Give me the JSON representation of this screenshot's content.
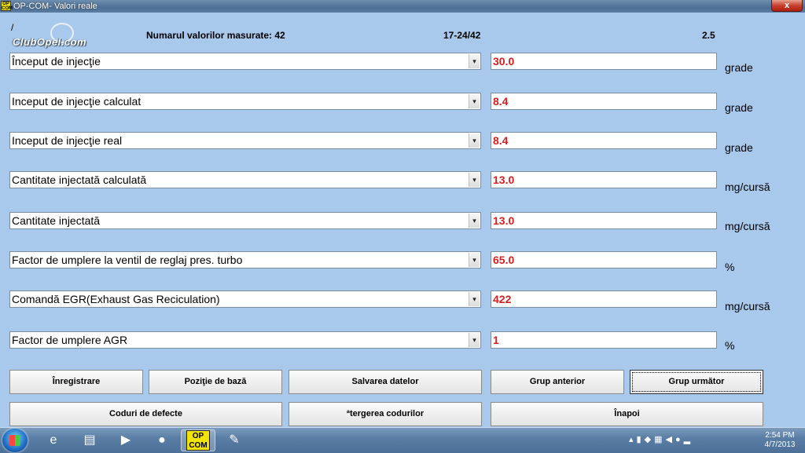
{
  "window": {
    "title": "OP-COM- Valori reale",
    "app_icon_line1": "OP",
    "app_icon_line2": "COM",
    "close_label": "x"
  },
  "header": {
    "slash": "/",
    "logo": "ClubOpel.com",
    "count_label": "Numarul valorilor masurate: 42",
    "range": "17-24/42",
    "version": "2.5"
  },
  "rows": [
    {
      "label": "Început de injecţie",
      "value": "30.0",
      "unit": "grade"
    },
    {
      "label": "Inceput de injecţie calculat",
      "value": "8.4",
      "unit": "grade"
    },
    {
      "label": "Inceput de injecţie real",
      "value": "8.4",
      "unit": "grade"
    },
    {
      "label": "Cantitate injectată calculată",
      "value": "13.0",
      "unit": "mg/cursă"
    },
    {
      "label": "Cantitate injectată",
      "value": "13.0",
      "unit": "mg/cursă"
    },
    {
      "label": "Factor de umplere la ventil  de reglaj pres. turbo",
      "value": "65.0",
      "unit": "%"
    },
    {
      "label": "Comandă EGR(Exhaust Gas Reciculation)",
      "value": "422",
      "unit": "mg/cursă"
    },
    {
      "label": "Factor de umplere AGR",
      "value": "1",
      "unit": "%"
    }
  ],
  "buttons": {
    "record": "Înregistrare",
    "base_position": "Poziţie de bază",
    "save_data": "Salvarea datelor",
    "prev_group": "Grup anterior",
    "next_group": "Grup următor",
    "fault_codes": "Coduri de defecte",
    "clear_codes": "ªtergerea codurilor",
    "back": "Înapoi"
  },
  "taskbar": {
    "opcom_line1": "OP",
    "opcom_line2": "COM",
    "time": "2:54 PM",
    "date": "4/7/2013"
  },
  "icons": {
    "dropdown": "chevron-down-icon",
    "start": "windows-start-icon"
  }
}
